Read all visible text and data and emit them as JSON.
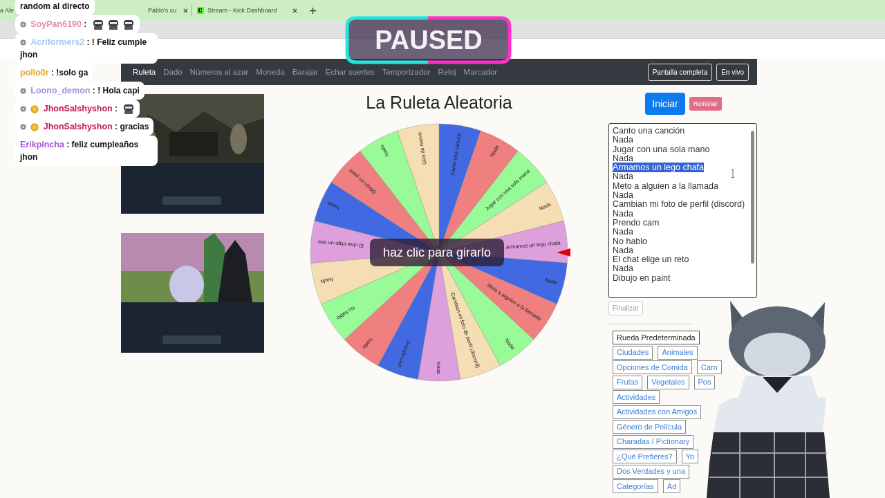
{
  "browser": {
    "tabs": [
      {
        "title": "a Ale",
        "kind": "plain",
        "closable": false
      },
      {
        "title": "Pablo's cu",
        "kind": "plain",
        "closable": true
      },
      {
        "title": "Stream - Kick Dashboard",
        "kind": "kick",
        "closable": true
      }
    ]
  },
  "chat": [
    {
      "kind": "continuation",
      "text": "random al directo"
    },
    {
      "kind": "message",
      "user": "SoyPan6190",
      "color": "#e58bb4",
      "separator": ":",
      "dot_badge": true,
      "coin_badge": false,
      "emotes": [
        {
          "kind": "emote"
        },
        {
          "kind": "emote"
        },
        {
          "kind": "emote"
        }
      ]
    },
    {
      "kind": "message",
      "user": "Acriformers2",
      "color": "#a9c9e8",
      "separator": ":",
      "dot_badge": true,
      "coin_badge": false,
      "text": "! Feliz cumple jhon"
    },
    {
      "kind": "message",
      "user": "pollo0r",
      "color": "#e4a822",
      "separator": ":",
      "dot_badge": false,
      "coin_badge": false,
      "text": "!solo ga"
    },
    {
      "kind": "message",
      "user": "Loono_demon",
      "color": "#9c93e0",
      "separator": ":",
      "dot_badge": true,
      "coin_badge": false,
      "text": "! Hola capi"
    },
    {
      "kind": "message",
      "user": "JhonSalshyshon",
      "color": "#c2185b",
      "separator": ":",
      "dot_badge": true,
      "coin_badge": true,
      "emotes": [
        {
          "kind": "emote"
        }
      ]
    },
    {
      "kind": "message",
      "user": "JhonSalshyshon",
      "color": "#c2185b",
      "separator": ":",
      "dot_badge": true,
      "coin_badge": true,
      "text": "gracias"
    },
    {
      "kind": "message",
      "user": "Erikpincha",
      "color": "#a855d6",
      "separator": ":",
      "dot_badge": false,
      "coin_badge": false,
      "text": "feliz cumpleaños jhon"
    }
  ],
  "stream_status": "PAUSED",
  "nav": {
    "items": [
      {
        "label": "Ruleta",
        "selected": true
      },
      {
        "label": "Dado",
        "selected": false
      },
      {
        "label": "Números al azar",
        "selected": false
      },
      {
        "label": "Moneda",
        "selected": false
      },
      {
        "label": "Barajar",
        "selected": false
      },
      {
        "label": "Echar suertes",
        "selected": false
      },
      {
        "label": "Temporizador",
        "selected": false
      },
      {
        "label": "Reloj",
        "selected": false
      },
      {
        "label": "Marcador",
        "selected": false
      }
    ],
    "buttons": [
      "Pantalla completa",
      "En vivo"
    ]
  },
  "ads": [
    {
      "kind": "picture"
    },
    {
      "kind": "picture"
    }
  ],
  "title": "La Ruleta Aleatoria",
  "wheel": {
    "overlay_text": "haz clic para girarlo",
    "segments": [
      {
        "label": "Canto una canción",
        "color": "#4169e1"
      },
      {
        "label": "Nada",
        "color": "#f08080"
      },
      {
        "label": "Jugar con una sola mano",
        "color": "#98fb98"
      },
      {
        "label": "Nada",
        "color": "#f5deb3"
      },
      {
        "label": "Armamos un lego chafa",
        "color": "#dda0dd"
      },
      {
        "label": "Nada",
        "color": "#4169e1"
      },
      {
        "label": "Meto a alguien a la llamada",
        "color": "#f08080"
      },
      {
        "label": "Nada",
        "color": "#98fb98"
      },
      {
        "label": "Cambian mi foto de perfil (discord)",
        "color": "#f5deb3"
      },
      {
        "label": "Nada",
        "color": "#dda0dd"
      },
      {
        "label": "Prendo cam",
        "color": "#4169e1"
      },
      {
        "label": "Nada",
        "color": "#f08080"
      },
      {
        "label": "No hablo",
        "color": "#98fb98"
      },
      {
        "label": "Nada",
        "color": "#f5deb3"
      },
      {
        "label": "El chat elige un reto",
        "color": "#dda0dd"
      },
      {
        "label": "Nada",
        "color": "#4169e1"
      },
      {
        "label": "Dibujo en paint",
        "color": "#f08080"
      },
      {
        "label": "Nada",
        "color": "#98fb98"
      },
      {
        "label": "Gira de nuevo",
        "color": "#f5deb3"
      }
    ]
  },
  "start_button": "Iniciar",
  "reset_button": "Reiniciar",
  "options": [
    {
      "text": "Canto una canción",
      "selected": false
    },
    {
      "text": "Nada",
      "selected": false
    },
    {
      "text": "Jugar con una sola mano",
      "selected": false
    },
    {
      "text": "Nada",
      "selected": false
    },
    {
      "text": "Armamos un lego chafa",
      "selected": true
    },
    {
      "text": "Nada",
      "selected": false
    },
    {
      "text": "Meto a alguien a la llamada",
      "selected": false
    },
    {
      "text": "Nada",
      "selected": false
    },
    {
      "text": "Cambian mi foto de perfil (discord)",
      "selected": false
    },
    {
      "text": "Nada",
      "selected": false
    },
    {
      "text": "Prendo cam",
      "selected": false
    },
    {
      "text": "Nada",
      "selected": false
    },
    {
      "text": "No hablo",
      "selected": false
    },
    {
      "text": "Nada",
      "selected": false
    },
    {
      "text": "El chat elige un reto",
      "selected": false
    },
    {
      "text": "Nada",
      "selected": false
    },
    {
      "text": "Dibujo en paint",
      "selected": false
    }
  ],
  "finish_button": {
    "label": "Finalizar",
    "disabled": true
  },
  "preset_rows": [
    [
      {
        "label": "Rueda Predeterminada",
        "selected": true
      }
    ],
    [
      {
        "label": "Ciudades",
        "selected": false
      },
      {
        "label": "Animales",
        "selected": false
      }
    ],
    [
      {
        "label": "Opciones de Comida",
        "selected": false
      },
      {
        "label": "Carn",
        "selected": false
      }
    ],
    [
      {
        "label": "Frutas",
        "selected": false
      },
      {
        "label": "Vegetales",
        "selected": false
      },
      {
        "label": "Pos",
        "selected": false
      }
    ],
    [
      {
        "label": "Actividades",
        "selected": false
      }
    ],
    [
      {
        "label": "Actividades con Amigos",
        "selected": false
      }
    ],
    [
      {
        "label": "Género de Película",
        "selected": false
      }
    ],
    [
      {
        "label": "Charadas / Pictionary",
        "selected": false
      }
    ],
    [
      {
        "label": "¿Qué Prefieres?",
        "selected": false
      },
      {
        "label": "Yo",
        "selected": false
      }
    ],
    [
      {
        "label": "Dos Verdades y una",
        "selected": false
      }
    ],
    [
      {
        "label": "Categorías",
        "selected": false
      },
      {
        "label": "Ad",
        "selected": false
      }
    ]
  ]
}
